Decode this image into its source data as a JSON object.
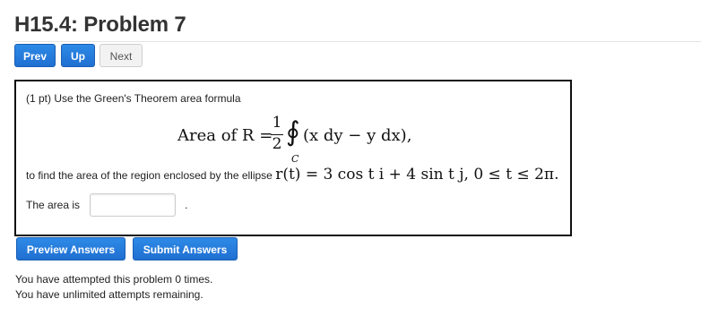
{
  "page": {
    "title": "H15.4: Problem 7"
  },
  "nav": {
    "prev_label": "Prev",
    "up_label": "Up",
    "next_label": "Next"
  },
  "problem": {
    "points_intro": "(1 pt) Use the Green's Theorem area formula",
    "formula": {
      "lhs": "Area of R =",
      "numerator": "1",
      "denominator": "2",
      "integral_symbol": "∮",
      "contour": "C",
      "integrand": "(x dy − y dx),"
    },
    "instruction_prefix": "to find the area of the region enclosed by the ellipse ",
    "ellipse_equation": "r(t) = 3 cos t i + 4 sin t j, 0 ≤ t ≤ 2π.",
    "answer_label": "The area is",
    "answer_value": "",
    "answer_suffix": "."
  },
  "actions": {
    "preview_label": "Preview Answers",
    "submit_label": "Submit Answers"
  },
  "status": {
    "attempts": "You have attempted this problem 0 times.",
    "remaining": "You have unlimited attempts remaining."
  },
  "colors": {
    "primary_button": "#1f6fd1",
    "secondary_button": "#f2f2f2",
    "box_border": "#111111"
  }
}
